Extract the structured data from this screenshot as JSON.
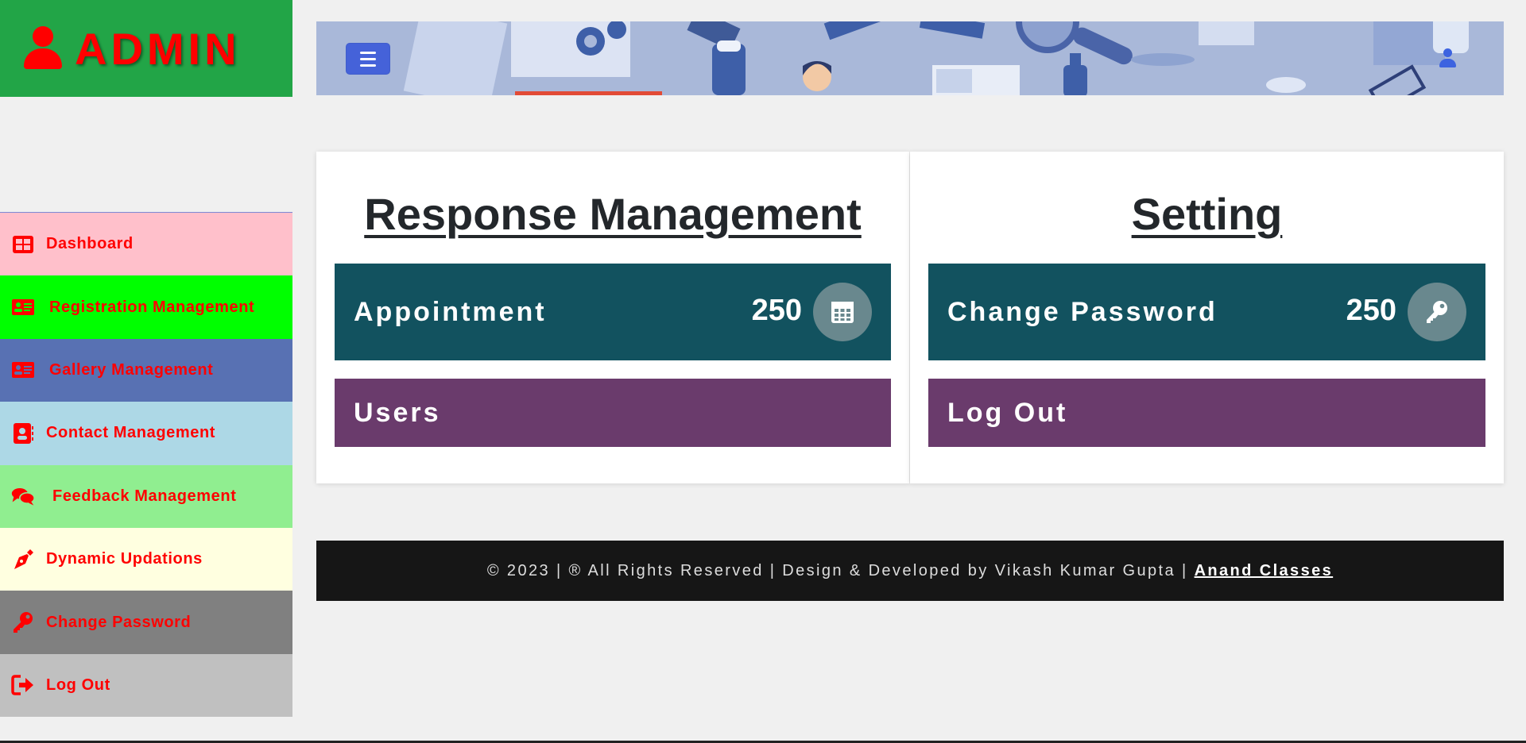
{
  "brand": {
    "title": "ADMIN",
    "icon": "user-icon",
    "color": "#ff0000",
    "bg": "#22a547"
  },
  "sidebar": {
    "items": [
      {
        "label": "Dashboard",
        "icon": "table-grid-icon",
        "bg": "#ffc0cb"
      },
      {
        "label": "Registration Management",
        "icon": "id-card-icon",
        "bg": "#00ff00"
      },
      {
        "label": "Gallery Management",
        "icon": "id-card-icon",
        "bg": "#5871b3"
      },
      {
        "label": "Contact Management",
        "icon": "address-book-icon",
        "bg": "#add8e6"
      },
      {
        "label": "Feedback Management",
        "icon": "comments-icon",
        "bg": "#90ee90"
      },
      {
        "label": "Dynamic Updations",
        "icon": "pen-nib-icon",
        "bg": "#ffffe0"
      },
      {
        "label": "Change Password",
        "icon": "key-icon",
        "bg": "#808080"
      },
      {
        "label": "Log Out",
        "icon": "sign-out-icon",
        "bg": "#c0c0c0"
      }
    ]
  },
  "header": {
    "toggle_icon": "hamburger-icon",
    "user_icon": "user-icon"
  },
  "panels": {
    "response": {
      "title": "Response Management",
      "card": {
        "label": "Appointment",
        "count": "250",
        "icon": "calendar-icon"
      },
      "bar": {
        "label": "Users"
      }
    },
    "setting": {
      "title": "Setting",
      "card": {
        "label": "Change Password",
        "count": "250",
        "icon": "key-icon"
      },
      "bar": {
        "label": "Log Out"
      }
    }
  },
  "footer": {
    "text": "© 2023 | ® All Rights Reserved | Design & Developed by Vikash Kumar Gupta |",
    "link": "Anand Classes"
  },
  "colors": {
    "card": "#12525f",
    "bar": "#6a3b6c",
    "footer_bg": "#161616",
    "page_bg": "#f0f0f0"
  }
}
